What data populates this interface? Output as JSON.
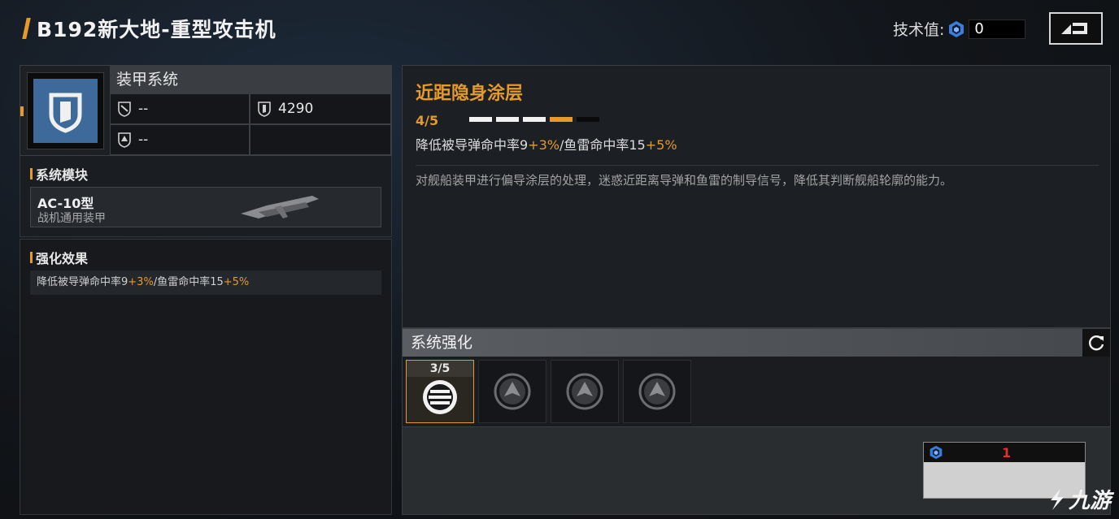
{
  "header": {
    "title": "B192新大地-重型攻击机",
    "tech_label": "技术值:",
    "tech_value": "0",
    "back_icon": "back-arrow-icon"
  },
  "armor": {
    "title": "装甲系统",
    "icon": "shield-icon",
    "stats": [
      {
        "icon": "evasion-icon",
        "value": "--"
      },
      {
        "icon": "armor-shield-icon",
        "value": "4290"
      },
      {
        "icon": "resist-icon",
        "value": "--"
      },
      {
        "icon": "",
        "value": ""
      }
    ]
  },
  "module": {
    "section_title": "系统模块",
    "name": "AC-10型",
    "subtitle": "战机通用装甲"
  },
  "effect": {
    "section_title": "强化效果",
    "text_a": "降低被导弹命中率9",
    "hl_a": "+3%",
    "text_b": "/鱼雷命中率15",
    "hl_b": "+5%"
  },
  "skill": {
    "title": "近距隐身涂层",
    "level": "4/5",
    "level_current": 4,
    "level_max": 5,
    "stat_a": "降低被导弹命中率9",
    "hl_a": "+3%",
    "stat_b": "/鱼雷命中率15",
    "hl_b": "+5%",
    "description": "对舰船装甲进行偏导涂层的处理，迷惑近距离导弹和鱼雷的制导信号，降低其判断舰船轮廓的能力。"
  },
  "system_upgrade": {
    "title": "系统强化",
    "refresh_icon": "refresh-icon",
    "slots": [
      {
        "count": "3/5",
        "icon": "stripes-icon",
        "active": true
      },
      {
        "count": "",
        "icon": "locked-ship-icon",
        "active": false
      },
      {
        "count": "",
        "icon": "locked-ship-icon",
        "active": false
      },
      {
        "count": "",
        "icon": "locked-ship-icon",
        "active": false
      }
    ],
    "cost_value": "1",
    "cost_icon": "tech-point-icon"
  },
  "watermark": "九游",
  "colors": {
    "accent": "#e59a2a",
    "armor_blue": "#3d6a9a",
    "cost_red": "#e03030"
  }
}
